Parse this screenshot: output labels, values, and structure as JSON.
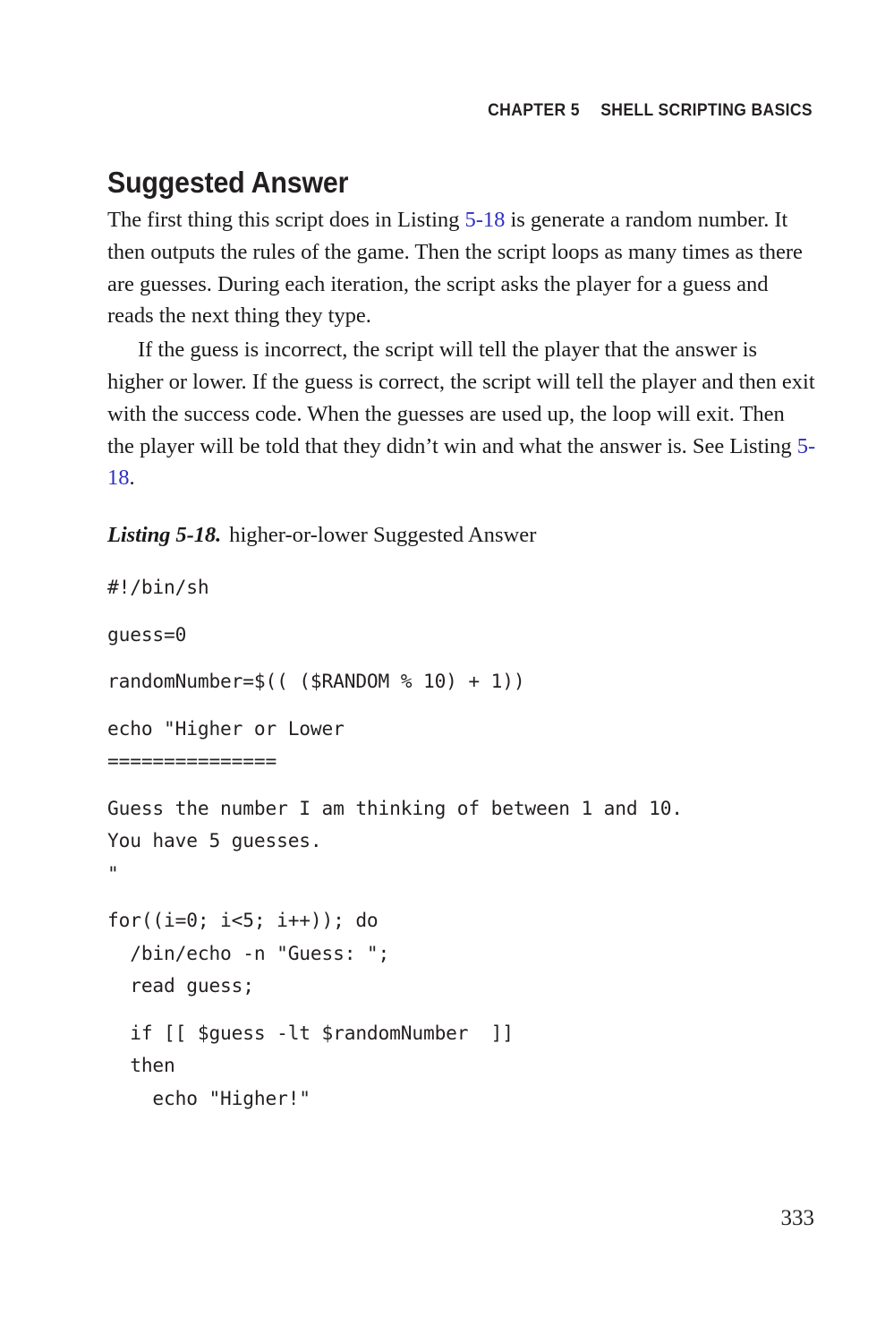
{
  "running_head": {
    "chapter": "CHAPTER 5",
    "title": "SHELL SCRIPTING BASICS"
  },
  "section": {
    "heading": "Suggested Answer"
  },
  "paragraphs": [
    {
      "id": "para-1",
      "indented": false,
      "runs": [
        {
          "text": "The first thing this script does in Listing "
        },
        {
          "text": "5-18",
          "style": "link"
        },
        {
          "text": " is generate a random number. It then outputs the rules of the game. Then the script loops as many times as there are guesses. During each iteration, the script asks the player for a guess and reads the next thing they type."
        }
      ]
    },
    {
      "id": "para-2",
      "indented": true,
      "runs": [
        {
          "text": "If the guess is incorrect, the script will tell the player that the answer is higher or lower. If the guess is correct, the script will tell the player and then exit with the success code. When the guesses are used up, the loop will exit. Then the player will be told that they didn’t win and what the answer is. See Listing "
        },
        {
          "text": "5-18",
          "style": "link"
        },
        {
          "text": "."
        }
      ]
    }
  ],
  "listing": {
    "label": "Listing 5-18.",
    "title": "higher-or-lower Suggested Answer",
    "lines": [
      {
        "text": "#!/bin/sh",
        "gap_before": false
      },
      {
        "text": "guess=0",
        "gap_before": true
      },
      {
        "text": "randomNumber=$(( ($RANDOM % 10) + 1))",
        "gap_before": true
      },
      {
        "text": "echo \"Higher or Lower",
        "gap_before": true
      },
      {
        "text": "===============",
        "gap_before": false
      },
      {
        "text": "Guess the number I am thinking of between 1 and 10.",
        "gap_before": true
      },
      {
        "text": "You have 5 guesses.",
        "gap_before": false
      },
      {
        "text": "\"",
        "gap_before": false
      },
      {
        "text": "for((i=0; i<5; i++)); do",
        "gap_before": true
      },
      {
        "text": "  /bin/echo -n \"Guess: \";",
        "gap_before": false
      },
      {
        "text": "  read guess;",
        "gap_before": false
      },
      {
        "text": "  if [[ $guess -lt $randomNumber  ]]",
        "gap_before": true
      },
      {
        "text": "  then",
        "gap_before": false
      },
      {
        "text": "    echo \"Higher!\"",
        "gap_before": false
      }
    ]
  },
  "folio": {
    "page_number": "333"
  },
  "colors": {
    "text": "#1a1a1a",
    "heading": "#231f20",
    "link": "#2f2fc4",
    "background": "#ffffff"
  }
}
